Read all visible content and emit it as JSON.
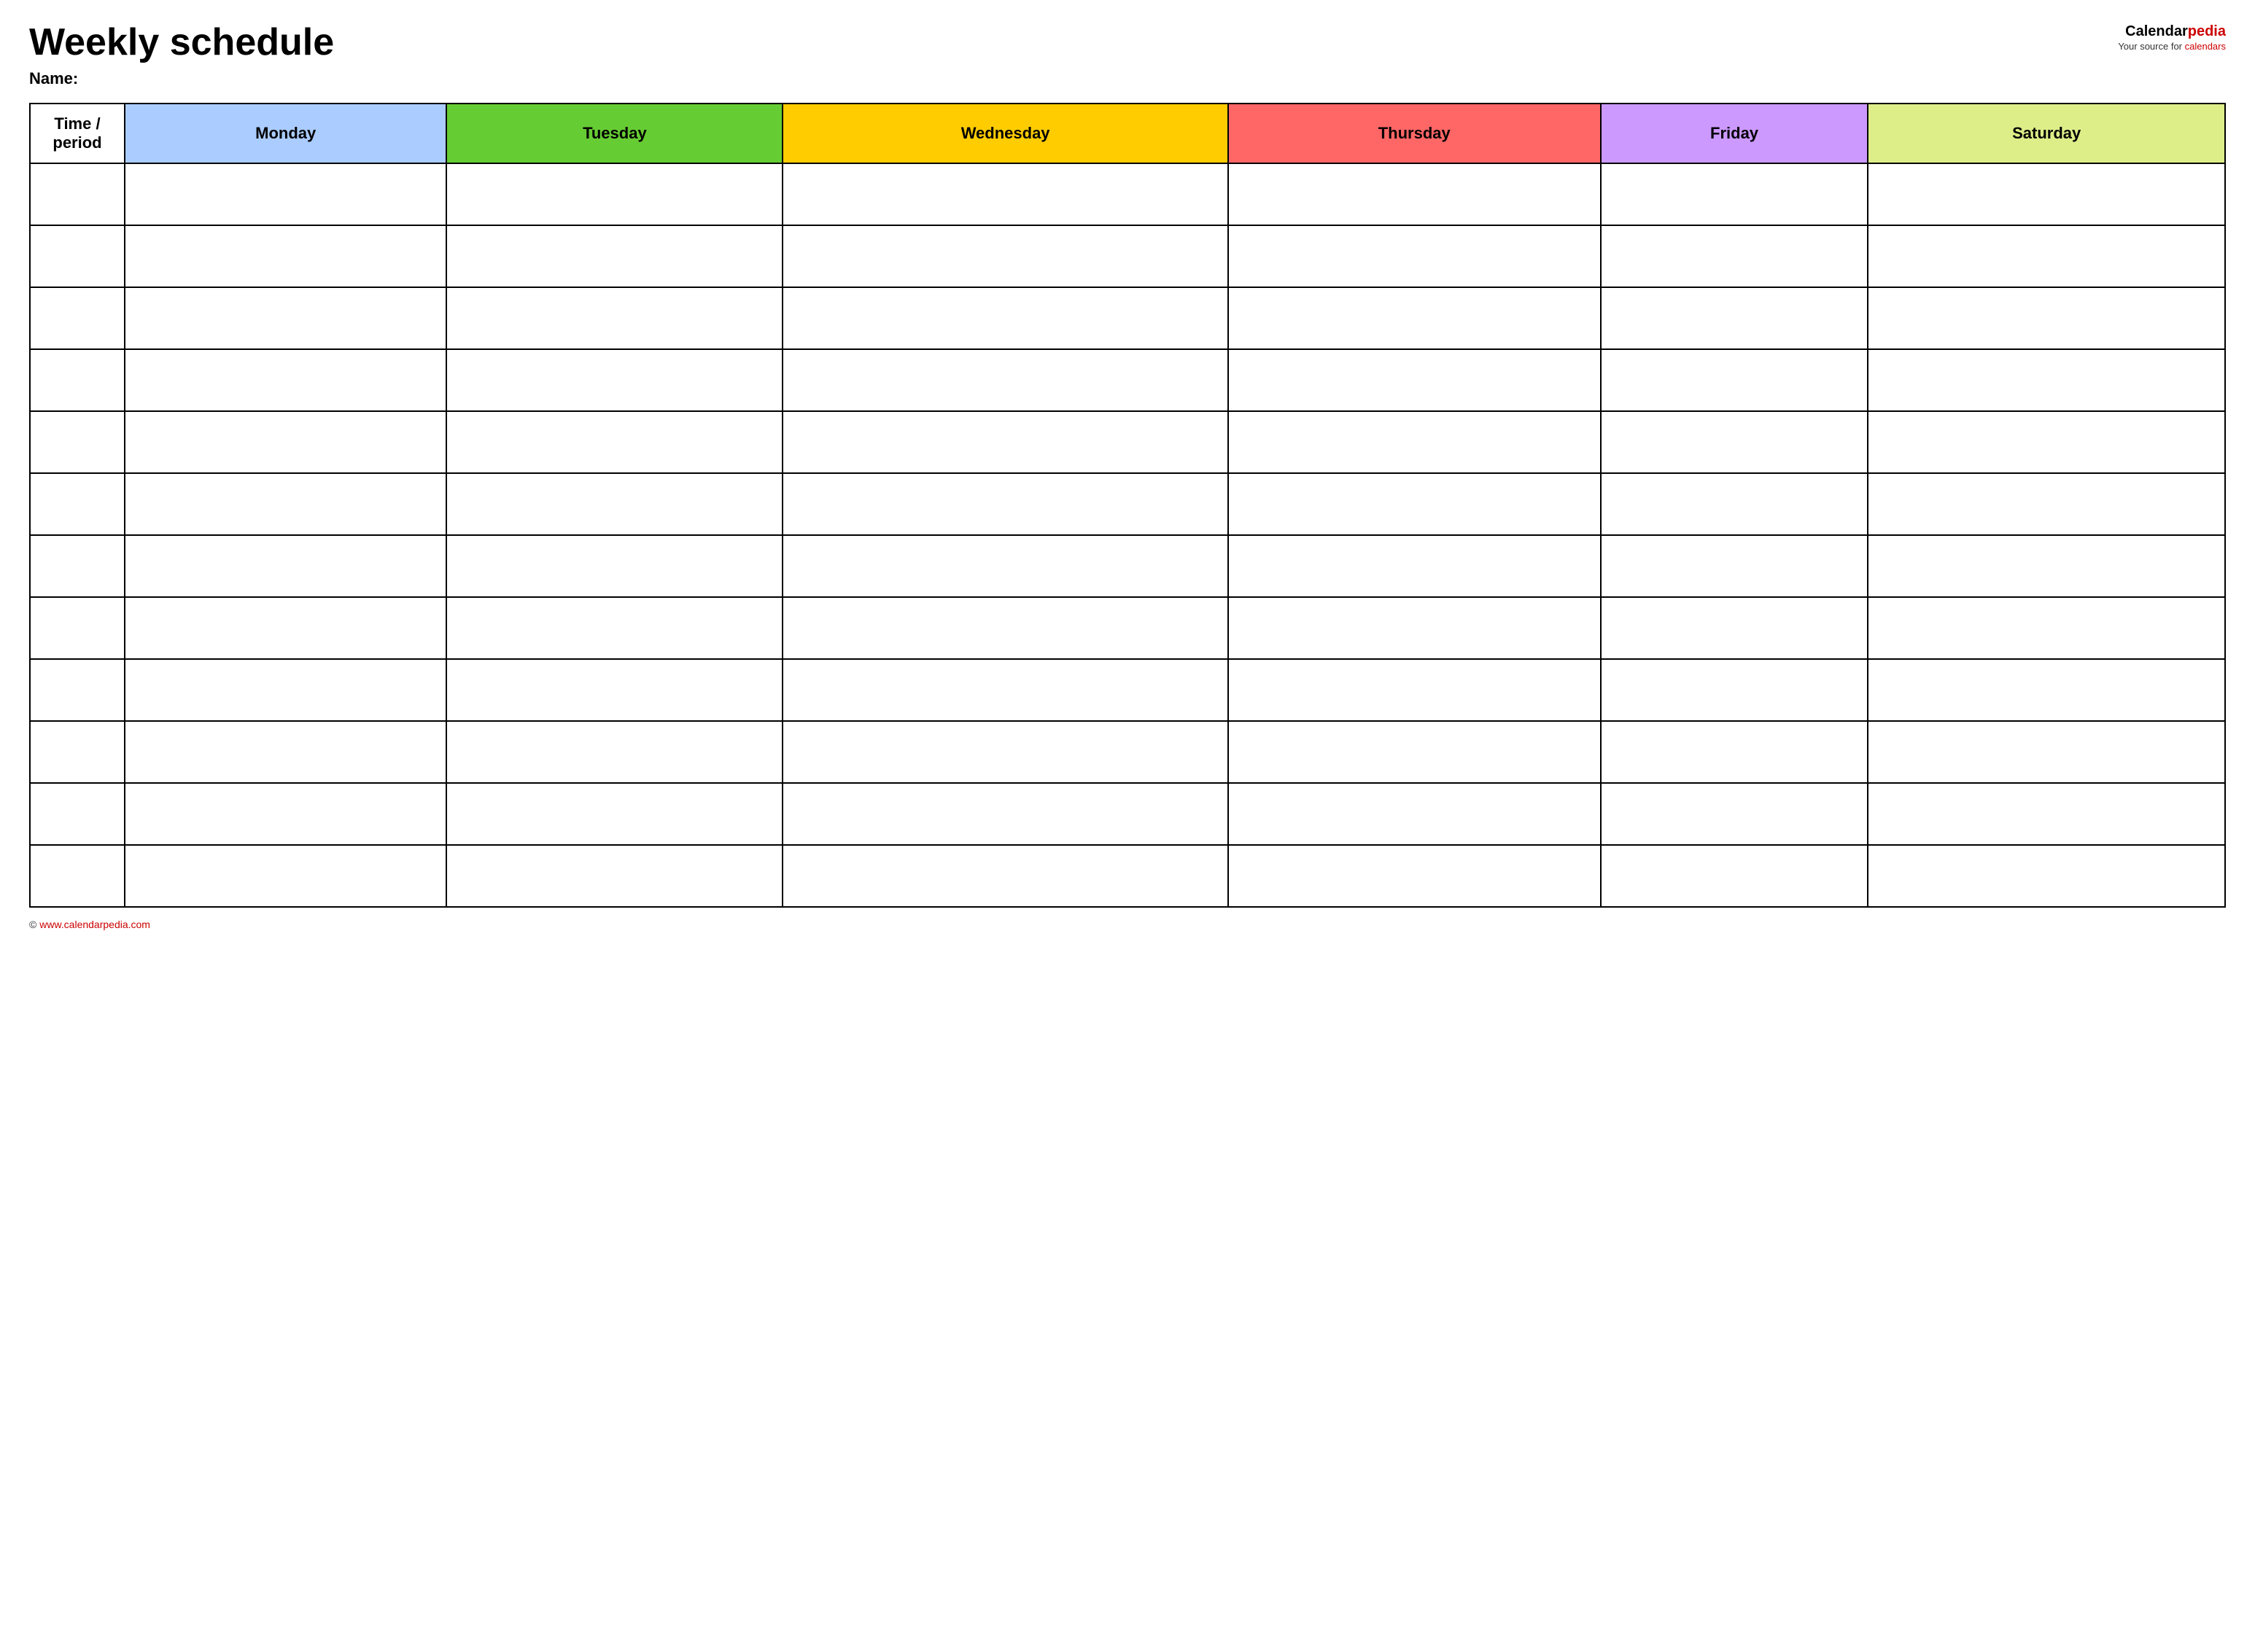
{
  "page": {
    "title": "Weekly schedule",
    "name_label": "Name:",
    "logo": {
      "calendar_text": "Calendar",
      "pedia_text": "pedia",
      "subtitle": "Your source for calendars",
      "website": "www.calendarpedia.com"
    },
    "columns": [
      {
        "id": "time",
        "label": "Time / period",
        "color": "#ffffff"
      },
      {
        "id": "monday",
        "label": "Monday",
        "color": "#aaccff"
      },
      {
        "id": "tuesday",
        "label": "Tuesday",
        "color": "#66cc33"
      },
      {
        "id": "wednesday",
        "label": "Wednesday",
        "color": "#ffcc00"
      },
      {
        "id": "thursday",
        "label": "Thursday",
        "color": "#ff6666"
      },
      {
        "id": "friday",
        "label": "Friday",
        "color": "#cc99ff"
      },
      {
        "id": "saturday",
        "label": "Saturday",
        "color": "#ddee88"
      }
    ],
    "rows": 12,
    "footer_text": "© www.calendarpedia.com"
  }
}
